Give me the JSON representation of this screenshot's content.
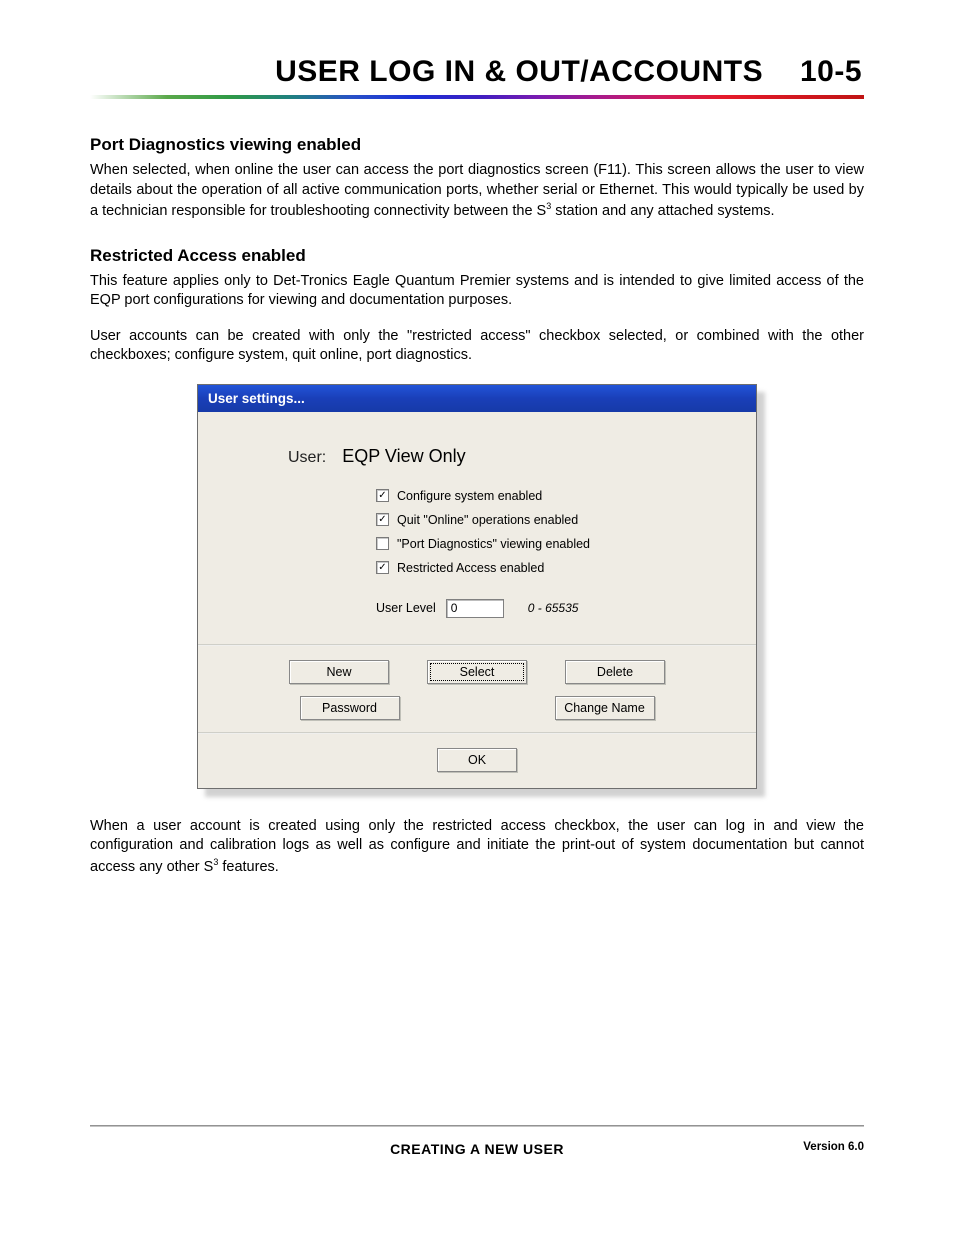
{
  "header": {
    "title": "USER LOG IN & OUT/ACCOUNTS",
    "pagenum": "10-5"
  },
  "sections": {
    "s1": {
      "heading": "Port Diagnostics viewing enabled",
      "para1a": "When selected, when online the user can access the port diagnostics screen (F11).  This screen allows the user to view details about the operation of all active communication ports, whether serial or Ethernet.  This would typically be used by a technician responsible for troubleshooting connectivity between the S",
      "para1b": " station and any attached systems."
    },
    "s2": {
      "heading": "Restricted Access enabled",
      "para1": "This feature applies only to Det-Tronics Eagle Quantum Premier systems and is intended to give limited access of the EQP port configurations for viewing and documentation purposes.",
      "para2": "User accounts can be created with only the \"restricted access\" checkbox selected, or combined with the other checkboxes; configure system, quit online, port diagnostics."
    },
    "afterDialog": {
      "para_a": "When a user account is created using only the restricted access checkbox, the user can log in and view the configuration and calibration logs as well as configure and initiate the print-out of system documentation but cannot access any other S",
      "para_b": " features."
    }
  },
  "dialog": {
    "title": "User settings...",
    "userLabel": "User:",
    "userValue": "EQP View Only",
    "checkboxes": [
      {
        "label": "Configure system enabled",
        "checked": true
      },
      {
        "label": "Quit \"Online\" operations enabled",
        "checked": true
      },
      {
        "label": "\"Port Diagnostics\" viewing enabled",
        "checked": false
      },
      {
        "label": "Restricted Access enabled",
        "checked": true
      }
    ],
    "level": {
      "label": "User Level",
      "value": "0",
      "range": "0 - 65535"
    },
    "buttons": {
      "new": "New",
      "select": "Select",
      "delete": "Delete",
      "password": "Password",
      "changeName": "Change Name",
      "ok": "OK"
    }
  },
  "footer": {
    "title": "CREATING A NEW USER",
    "version": "Version 6.0"
  },
  "superscript3": "3"
}
